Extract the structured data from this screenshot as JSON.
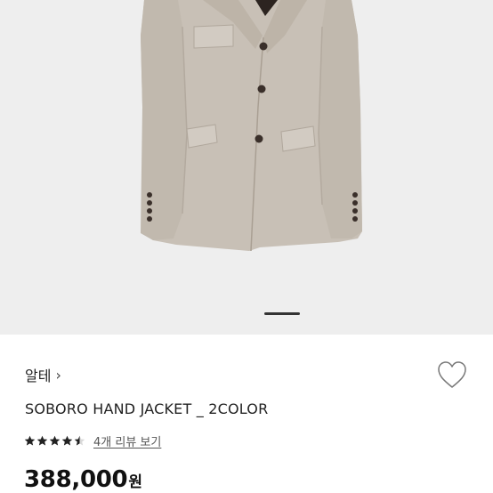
{
  "product": {
    "brand": "알테",
    "title": "SOBORO HAND JACKET _ 2COLOR",
    "rating": 4.5,
    "review_link": "4개 리뷰 보기",
    "price_amount": "388,000",
    "price_unit": "원"
  },
  "gallery": {
    "image_label": "jacket-image"
  },
  "colors": {
    "background": "#eeeeee",
    "jacket": "#c8c0b6",
    "button": "#3a2f2a",
    "text": "#111111"
  },
  "icons": {
    "brand_chevron": "chevron-right-icon",
    "wishlist": "heart-icon",
    "star": "star-icon"
  }
}
